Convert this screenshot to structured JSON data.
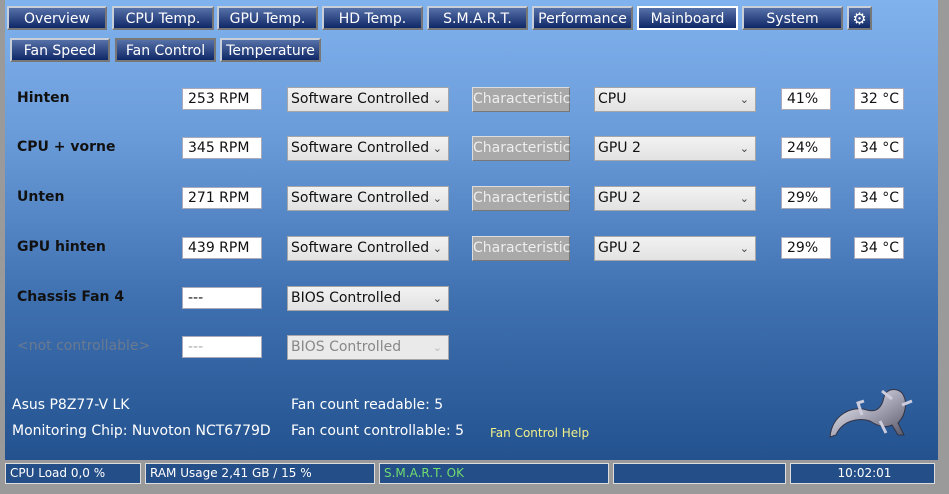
{
  "tabs": [
    "Overview",
    "CPU Temp.",
    "GPU Temp.",
    "HD Temp.",
    "S.M.A.R.T.",
    "Performance",
    "Mainboard",
    "System"
  ],
  "subtabs": [
    "Fan Speed",
    "Fan Control",
    "Temperature"
  ],
  "fans": [
    {
      "name": "Hinten",
      "rpm": "253 RPM",
      "mode": "Software Controlled",
      "button": "Characteristic",
      "source": "CPU",
      "percent": "41%",
      "temp": "32 °C"
    },
    {
      "name": "CPU + vorne",
      "rpm": "345 RPM",
      "mode": "Software Controlled",
      "button": "Characteristic",
      "source": "GPU 2",
      "percent": "24%",
      "temp": "34 °C"
    },
    {
      "name": "Unten",
      "rpm": "271 RPM",
      "mode": "Software Controlled",
      "button": "Characteristic",
      "source": "GPU 2",
      "percent": "29%",
      "temp": "34 °C"
    },
    {
      "name": "GPU hinten",
      "rpm": "439 RPM",
      "mode": "Software Controlled",
      "button": "Characteristic",
      "source": "GPU 2",
      "percent": "29%",
      "temp": "34 °C"
    },
    {
      "name": "Chassis Fan 4",
      "rpm": "---",
      "mode": "BIOS Controlled"
    },
    {
      "name": "<not controllable>",
      "rpm": "---",
      "mode": "BIOS Controlled"
    }
  ],
  "info": {
    "board": "Asus P8Z77-V LK",
    "chip": "Monitoring Chip: Nuvoton NCT6779D",
    "readable": "Fan count readable: 5",
    "controllable": "Fan count controllable: 5",
    "help": "Fan Control Help"
  },
  "status": {
    "cpu": "CPU Load 0,0 %",
    "ram": "RAM Usage 2,41 GB / 15 %",
    "smart": "S.M.A.R.T. OK",
    "empty": "",
    "time": "10:02:01"
  },
  "colors": {
    "smart_ok": "#6fdc6f",
    "help": "#f0f08a"
  }
}
